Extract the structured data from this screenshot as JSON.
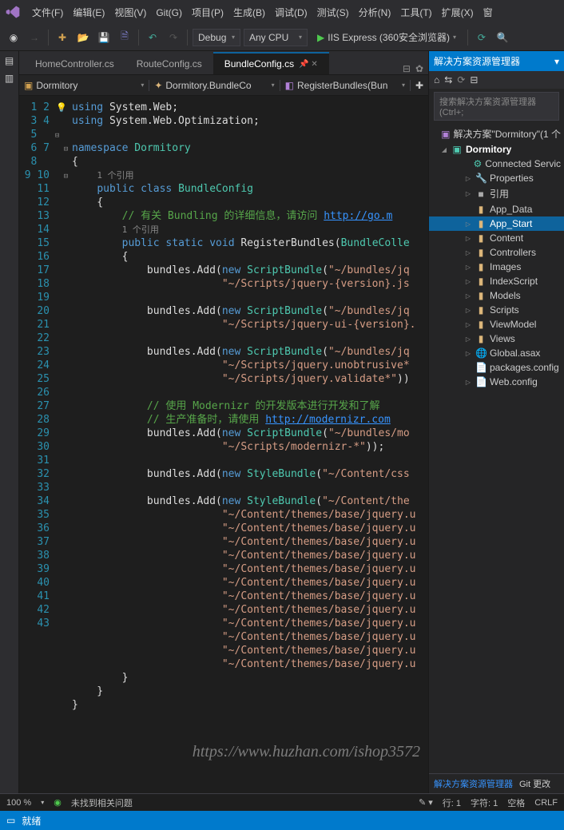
{
  "menu": [
    "文件(F)",
    "编辑(E)",
    "视图(V)",
    "Git(G)",
    "项目(P)",
    "生成(B)",
    "调试(D)",
    "测试(S)",
    "分析(N)",
    "工具(T)",
    "扩展(X)",
    "窗"
  ],
  "toolbar": {
    "config": "Debug",
    "platform": "Any CPU",
    "run": "IIS Express (360安全浏览器)"
  },
  "tabs": [
    {
      "label": "HomeController.cs",
      "active": false
    },
    {
      "label": "RouteConfig.cs",
      "active": false
    },
    {
      "label": "BundleConfig.cs",
      "active": true
    }
  ],
  "nav": {
    "ns": "Dormitory",
    "cls": "Dormitory.BundleCo",
    "mth": "RegisterBundles(Bun"
  },
  "code_lines": [
    {
      "n": 1,
      "f": "⊟",
      "bulb": true,
      "h": "<span class='kw'>using</span> System.Web;"
    },
    {
      "n": 2,
      "h": "<span class='kw'>using</span> System.Web.Optimization;"
    },
    {
      "n": 3,
      "h": ""
    },
    {
      "n": 4,
      "f": "⊟",
      "h": "<span class='kw'>namespace</span> <span class='typ'>Dormitory</span>"
    },
    {
      "n": 5,
      "h": "{"
    },
    {
      "n": "",
      "h": "    <span class='ref'>1 个引用</span>"
    },
    {
      "n": 6,
      "f": "⊟",
      "h": "    <span class='kw'>public</span> <span class='kw'>class</span> <span class='typ'>BundleConfig</span>"
    },
    {
      "n": 7,
      "h": "    {"
    },
    {
      "n": 8,
      "h": "        <span class='cmt'>// 有关 Bundling 的详细信息，请访问 </span><span class='lnk'>http://go.m</span>"
    },
    {
      "n": "",
      "h": "        <span class='ref'>1 个引用</span>"
    },
    {
      "n": 9,
      "f": "⊟",
      "h": "        <span class='kw'>public</span> <span class='kw'>static</span> <span class='kw'>void</span> RegisterBundles(<span class='typ'>BundleColle</span>"
    },
    {
      "n": 10,
      "h": "        {"
    },
    {
      "n": 11,
      "h": "            bundles.Add(<span class='kw'>new</span> <span class='typ'>ScriptBundle</span>(<span class='str'>\"~/bundles/jq</span>"
    },
    {
      "n": 12,
      "h": "                        <span class='str'>\"~/Scripts/jquery-{version}.js</span>"
    },
    {
      "n": 13,
      "h": ""
    },
    {
      "n": 14,
      "h": "            bundles.Add(<span class='kw'>new</span> <span class='typ'>ScriptBundle</span>(<span class='str'>\"~/bundles/jq</span>"
    },
    {
      "n": 15,
      "h": "                        <span class='str'>\"~/Scripts/jquery-ui-{version}.</span>"
    },
    {
      "n": 16,
      "h": ""
    },
    {
      "n": 17,
      "h": "            bundles.Add(<span class='kw'>new</span> <span class='typ'>ScriptBundle</span>(<span class='str'>\"~/bundles/jq</span>"
    },
    {
      "n": 18,
      "h": "                        <span class='str'>\"~/Scripts/jquery.unobtrusive*</span>"
    },
    {
      "n": 19,
      "h": "                        <span class='str'>\"~/Scripts/jquery.validate*\"</span>))"
    },
    {
      "n": 20,
      "h": ""
    },
    {
      "n": 21,
      "h": "            <span class='cmt'>// 使用 Modernizr 的开发版本进行开发和了解</span>"
    },
    {
      "n": 22,
      "h": "            <span class='cmt'>// 生产准备时，请使用 </span><span class='lnk'>http://modernizr.com</span>"
    },
    {
      "n": 23,
      "h": "            bundles.Add(<span class='kw'>new</span> <span class='typ'>ScriptBundle</span>(<span class='str'>\"~/bundles/mo</span>"
    },
    {
      "n": 24,
      "h": "                        <span class='str'>\"~/Scripts/modernizr-*\"</span>));"
    },
    {
      "n": 25,
      "h": ""
    },
    {
      "n": 26,
      "h": "            bundles.Add(<span class='kw'>new</span> <span class='typ'>StyleBundle</span>(<span class='str'>\"~/Content/css</span>"
    },
    {
      "n": 27,
      "h": ""
    },
    {
      "n": 28,
      "h": "            bundles.Add(<span class='kw'>new</span> <span class='typ'>StyleBundle</span>(<span class='str'>\"~/Content/the</span>"
    },
    {
      "n": 29,
      "h": "                        <span class='str'>\"~/Content/themes/base/jquery.u</span>"
    },
    {
      "n": 30,
      "h": "                        <span class='str'>\"~/Content/themes/base/jquery.u</span>"
    },
    {
      "n": 31,
      "h": "                        <span class='str'>\"~/Content/themes/base/jquery.u</span>"
    },
    {
      "n": 32,
      "h": "                        <span class='str'>\"~/Content/themes/base/jquery.u</span>"
    },
    {
      "n": 33,
      "h": "                        <span class='str'>\"~/Content/themes/base/jquery.u</span>"
    },
    {
      "n": 34,
      "h": "                        <span class='str'>\"~/Content/themes/base/jquery.u</span>"
    },
    {
      "n": 35,
      "h": "                        <span class='str'>\"~/Content/themes/base/jquery.u</span>"
    },
    {
      "n": 36,
      "h": "                        <span class='str'>\"~/Content/themes/base/jquery.u</span>"
    },
    {
      "n": 37,
      "h": "                        <span class='str'>\"~/Content/themes/base/jquery.u</span>"
    },
    {
      "n": 38,
      "h": "                        <span class='str'>\"~/Content/themes/base/jquery.u</span>"
    },
    {
      "n": 39,
      "h": "                        <span class='str'>\"~/Content/themes/base/jquery.u</span>"
    },
    {
      "n": 40,
      "h": "                        <span class='str'>\"~/Content/themes/base/jquery.u</span>"
    },
    {
      "n": 41,
      "h": "        }"
    },
    {
      "n": 42,
      "h": "    }"
    },
    {
      "n": 43,
      "h": "}"
    }
  ],
  "solution": {
    "panel_title": "解决方案资源管理器",
    "search_placeholder": "搜索解决方案资源管理器(Ctrl+;",
    "root": "解决方案\"Dormitory\"(1 个",
    "project": "Dormitory",
    "nodes": [
      {
        "ico": "⚙",
        "label": "Connected Servic",
        "i": 3
      },
      {
        "ico": "🔧",
        "label": "Properties",
        "exp": "▷",
        "i": 3
      },
      {
        "ico": "■",
        "label": "引用",
        "exp": "▷",
        "i": 3,
        "col": "#aaa"
      },
      {
        "ico": "📁",
        "label": "App_Data",
        "i": 3
      },
      {
        "ico": "📁",
        "label": "App_Start",
        "exp": "▷",
        "i": 3,
        "sel": true
      },
      {
        "ico": "📁",
        "label": "Content",
        "exp": "▷",
        "i": 3
      },
      {
        "ico": "📁",
        "label": "Controllers",
        "exp": "▷",
        "i": 3
      },
      {
        "ico": "📁",
        "label": "Images",
        "exp": "▷",
        "i": 3
      },
      {
        "ico": "📁",
        "label": "IndexScript",
        "exp": "▷",
        "i": 3
      },
      {
        "ico": "📁",
        "label": "Models",
        "exp": "▷",
        "i": 3
      },
      {
        "ico": "📁",
        "label": "Scripts",
        "exp": "▷",
        "i": 3
      },
      {
        "ico": "📁",
        "label": "ViewModel",
        "exp": "▷",
        "i": 3
      },
      {
        "ico": "📁",
        "label": "Views",
        "exp": "▷",
        "i": 3
      },
      {
        "ico": "🌐",
        "label": "Global.asax",
        "exp": "▷",
        "i": 3,
        "col": "#6bb3e0"
      },
      {
        "ico": "📄",
        "label": "packages.config",
        "i": 3,
        "col": "#ccc"
      },
      {
        "ico": "📄",
        "label": "Web.config",
        "exp": "▷",
        "i": 3,
        "col": "#ccc"
      }
    ],
    "bottom": [
      "解决方案资源管理器",
      "Git 更改"
    ]
  },
  "status": {
    "zoom": "100 %",
    "issues": "未找到相关问题",
    "line": "行: 1",
    "col": "字符: 1",
    "spaces": "空格",
    "eol": "CRLF"
  },
  "appstatus": "就绪",
  "watermark": "https://www.huzhan.com/ishop3572"
}
